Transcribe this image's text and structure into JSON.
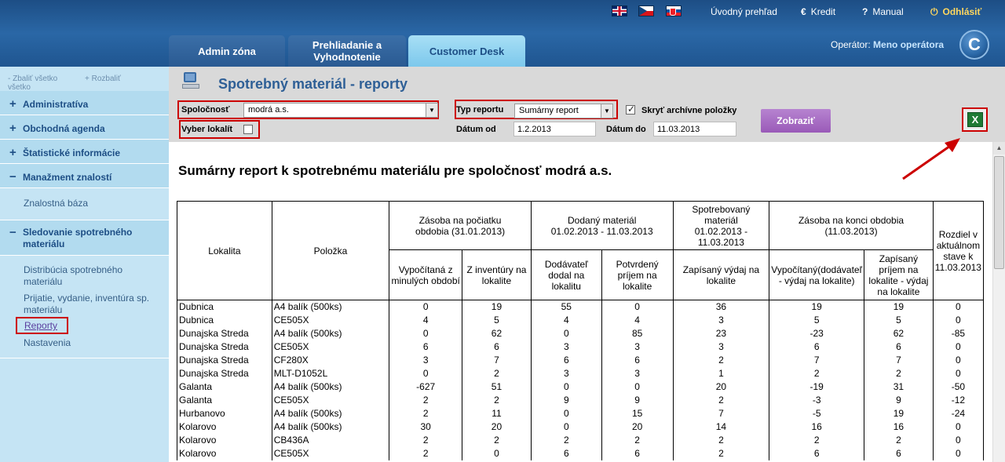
{
  "header": {
    "links": {
      "home": "Úvodný prehľad",
      "credit": "Kredit",
      "manual": "Manual",
      "logout": "Odhlásiť"
    },
    "tabs": {
      "admin": "Admin zóna",
      "review": "Prehliadanie a Vyhodnotenie",
      "desk": "Customer Desk"
    },
    "operator_label": "Operátor:",
    "operator_name": "Meno operátora",
    "logo_letter": "C"
  },
  "sidebar": {
    "collapse_all": "Zbaliť všetko",
    "expand_all": "Rozbaliť všetko",
    "sections": {
      "admin": "Administratíva",
      "business": "Obchodná agenda",
      "stats": "Štatistické informácie",
      "knowledge": "Manažment znalostí",
      "knowledge_base": "Znalostná báza",
      "consumables": "Sledovanie spotrebného materiálu",
      "distribution": "Distribúcia spotrebného materiálu",
      "intake": "Prijatie, vydanie, inventúra sp. materiálu",
      "reports": "Reporty",
      "settings": "Nastavenia"
    }
  },
  "page": {
    "title": "Spotrebný materiál - reporty",
    "report_title": "Sumárny report k spotrebnému materiálu pre spoločnosť modrá a.s."
  },
  "filters": {
    "company_label": "Spoločnosť",
    "company_value": "modrá a.s.",
    "location_label": "Vyber lokalít",
    "report_type_label": "Typ reportu",
    "report_type_value": "Sumárny report",
    "hide_archive_label": "Skryť archívne položky",
    "date_from_label": "Dátum od",
    "date_from_value": "1.2.2013",
    "date_to_label": "Dátum do",
    "date_to_value": "11.03.2013",
    "show_button": "Zobraziť",
    "excel_letter": "X"
  },
  "table": {
    "h_location": "Lokalita",
    "h_item": "Položka",
    "h_stock_start": "Zásoba na počiatku obdobia (31.01.2013)",
    "h_delivered": "Dodaný materiál 01.02.2013 - 11.03.2013",
    "h_consumed": "Spotrebovaný materiál 01.02.2013 - 11.03.2013",
    "h_stock_end": "Zásoba na konci obdobia (11.03.2013)",
    "h_diff": "Rozdiel v aktuálnom stave k 11.03.2013",
    "h_calc_prev": "Vypočítaná z minulých období",
    "h_inventory": "Z inventúry na lokalite",
    "h_supplier": "Dodávateľ dodal na lokalitu",
    "h_confirmed": "Potvrdený príjem na lokalite",
    "h_recorded_issue": "Zapísaný výdaj na lokalite",
    "h_calc_end": "Vypočítaný(dodávateľ - výdaj na lokalite)",
    "h_recorded_intake": "Zapísaný príjem na lokalite - výdaj na lokalite",
    "rows": [
      [
        "Dubnica",
        "A4 balík (500ks)",
        "0",
        "19",
        "55",
        "0",
        "36",
        "19",
        "19",
        "0"
      ],
      [
        "Dubnica",
        "CE505X",
        "4",
        "5",
        "4",
        "4",
        "3",
        "5",
        "5",
        "0"
      ],
      [
        "Dunajska Streda",
        "A4 balík (500ks)",
        "0",
        "62",
        "0",
        "85",
        "23",
        "-23",
        "62",
        "-85"
      ],
      [
        "Dunajska Streda",
        "CE505X",
        "6",
        "6",
        "3",
        "3",
        "3",
        "6",
        "6",
        "0"
      ],
      [
        "Dunajska Streda",
        "CF280X",
        "3",
        "7",
        "6",
        "6",
        "2",
        "7",
        "7",
        "0"
      ],
      [
        "Dunajska Streda",
        "MLT-D1052L",
        "0",
        "2",
        "3",
        "3",
        "1",
        "2",
        "2",
        "0"
      ],
      [
        "Galanta",
        "A4 balík (500ks)",
        "-627",
        "51",
        "0",
        "0",
        "20",
        "-19",
        "31",
        "-50"
      ],
      [
        "Galanta",
        "CE505X",
        "2",
        "2",
        "9",
        "9",
        "2",
        "-3",
        "9",
        "-12"
      ],
      [
        "Hurbanovo",
        "A4 balík (500ks)",
        "2",
        "11",
        "0",
        "15",
        "7",
        "-5",
        "19",
        "-24"
      ],
      [
        "Kolarovo",
        "A4 balík (500ks)",
        "30",
        "20",
        "0",
        "20",
        "14",
        "16",
        "16",
        "0"
      ],
      [
        "Kolarovo",
        "CB436A",
        "2",
        "2",
        "2",
        "2",
        "2",
        "2",
        "2",
        "0"
      ],
      [
        "Kolarovo",
        "CE505X",
        "2",
        "0",
        "6",
        "6",
        "2",
        "6",
        "6",
        "0"
      ]
    ]
  }
}
